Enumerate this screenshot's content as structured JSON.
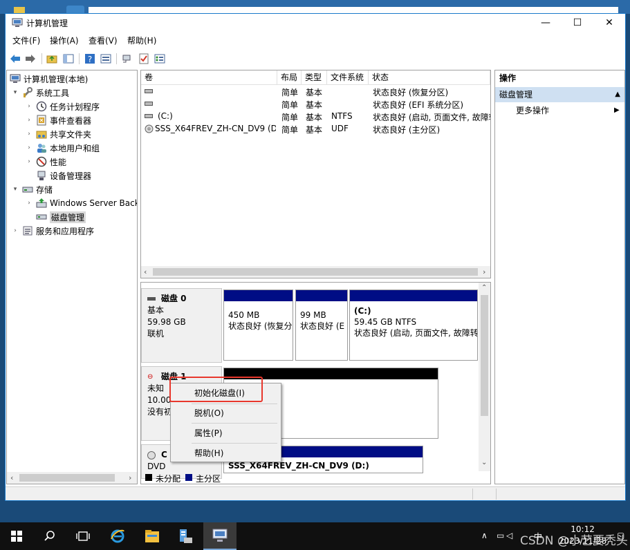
{
  "window": {
    "title": "计算机管理",
    "min": "—",
    "max": "☐",
    "close": "✕"
  },
  "menu": [
    "文件(F)",
    "操作(A)",
    "查看(V)",
    "帮助(H)"
  ],
  "tree": {
    "root": "计算机管理(本地)",
    "system_tools": "系统工具",
    "task_scheduler": "任务计划程序",
    "event_viewer": "事件查看器",
    "shared_folders": "共享文件夹",
    "local_users": "本地用户和组",
    "performance": "性能",
    "device_manager": "设备管理器",
    "storage": "存储",
    "windows_backup": "Windows Server Back",
    "disk_management": "磁盘管理",
    "services": "服务和应用程序"
  },
  "volume_table": {
    "headers": [
      "卷",
      "布局",
      "类型",
      "文件系统",
      "状态"
    ],
    "rows": [
      {
        "name": "",
        "layout": "简单",
        "type": "基本",
        "fs": "",
        "status": "状态良好 (恢复分区)"
      },
      {
        "name": "",
        "layout": "简单",
        "type": "基本",
        "fs": "",
        "status": "状态良好 (EFI 系统分区)"
      },
      {
        "name": "(C:)",
        "layout": "简单",
        "type": "基本",
        "fs": "NTFS",
        "status": "状态良好 (启动, 页面文件, 故障转"
      },
      {
        "name": "SSS_X64FREV_ZH-CN_DV9 (D:)",
        "layout": "简单",
        "type": "基本",
        "fs": "UDF",
        "status": "状态良好 (主分区)"
      }
    ]
  },
  "disks": {
    "disk0": {
      "name": "磁盘 0",
      "type": "基本",
      "size": "59.98 GB",
      "state": "联机"
    },
    "disk0_parts": [
      {
        "title": "",
        "size": "450 MB",
        "status": "状态良好 (恢复分"
      },
      {
        "title": "",
        "size": "99 MB",
        "status": "状态良好 (E"
      },
      {
        "title": "(C:)",
        "size": "59.45 GB NTFS",
        "status": "状态良好 (启动, 页面文件, 故障转"
      }
    ],
    "disk1": {
      "name": "磁盘 1",
      "type": "未知",
      "size": "10.00",
      "state": "没有初"
    },
    "cd": {
      "name": "C",
      "type": "DVD"
    },
    "cd_part": {
      "title": "SSS_X64FREV_ZH-CN_DV9  (D:)"
    }
  },
  "legend": {
    "unallocated": "未分配",
    "primary": "主分区"
  },
  "actions": {
    "header": "操作",
    "selected": "磁盘管理",
    "more": "更多操作"
  },
  "context_menu": {
    "init": "初始化磁盘(I)",
    "offline": "脱机(O)",
    "properties": "属性(P)",
    "help": "帮助(H)"
  },
  "taskbar": {
    "clock_time": "10:12",
    "clock_date": "2023/11/28",
    "ime": "中",
    "watermark": "CSDN @小艺要秃头"
  },
  "colors": {
    "partition_bar": "#000d85",
    "unallocated": "#000000",
    "highlight": "#e8372c",
    "action_selected": "#cfe0f2"
  }
}
